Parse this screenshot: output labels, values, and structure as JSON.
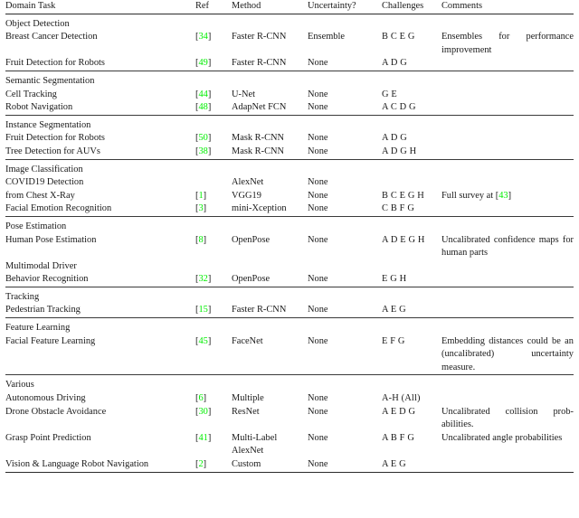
{
  "table": {
    "columns": [
      {
        "key": "domain",
        "label": "Domain Task"
      },
      {
        "key": "ref",
        "label": "Ref"
      },
      {
        "key": "method",
        "label": "Method"
      },
      {
        "key": "uncertainty",
        "label": "Uncertainty?"
      },
      {
        "key": "challenges",
        "label": "Challenges"
      },
      {
        "key": "comments",
        "label": "Comments"
      }
    ],
    "ref_color": "#00ee00",
    "sections": [
      {
        "name": "Object Detection",
        "rows": [
          {
            "domain": "Breast Cancer Detection",
            "ref_open": "[",
            "ref_num": "34",
            "ref_close": "]",
            "method": "Faster R-CNN",
            "uncertainty": "Ensemble",
            "challenges": "B C E G",
            "comments": "Ensembles for performance improvement"
          },
          {
            "domain": "Fruit Detection for Robots",
            "ref_open": "[",
            "ref_num": "49",
            "ref_close": "]",
            "method": "Faster R-CNN",
            "uncertainty": "None",
            "challenges": "A D G",
            "comments": ""
          }
        ]
      },
      {
        "name": "Semantic Segmentation",
        "rows": [
          {
            "domain": "Cell Tracking",
            "ref_open": "[",
            "ref_num": "44",
            "ref_close": "]",
            "method": "U-Net",
            "uncertainty": "None",
            "challenges": "G E",
            "comments": ""
          },
          {
            "domain": "Robot Navigation",
            "ref_open": "[",
            "ref_num": "48",
            "ref_close": "]",
            "method": "AdapNet FCN",
            "uncertainty": "None",
            "challenges": "A C D G",
            "comments": ""
          }
        ]
      },
      {
        "name": "Instance Segmentation",
        "rows": [
          {
            "domain": "Fruit Detection for Robots",
            "ref_open": "[",
            "ref_num": "50",
            "ref_close": "]",
            "method": "Mask R-CNN",
            "uncertainty": "None",
            "challenges": "A D G",
            "comments": ""
          },
          {
            "domain": "Tree Detection for AUVs",
            "ref_open": "[",
            "ref_num": "38",
            "ref_close": "]",
            "method": "Mask R-CNN",
            "uncertainty": "None",
            "challenges": "A D G H",
            "comments": ""
          }
        ]
      },
      {
        "name": "Image Classification",
        "rows": [
          {
            "domain": "COVID19 Detection",
            "ref_open": "",
            "ref_num": "",
            "ref_close": "",
            "method": "AlexNet",
            "uncertainty": "None",
            "challenges": "",
            "comments": ""
          },
          {
            "domain": "from Chest X-Ray",
            "ref_open": "[",
            "ref_num": "1",
            "ref_close": "]",
            "method": "VGG19",
            "uncertainty": "None",
            "challenges": "B C E G H",
            "comments_pre": "Full survey at ",
            "comments_ref_open": "[",
            "comments_ref_num": "43",
            "comments_ref_close": "]",
            "comments": ""
          },
          {
            "domain": "Facial Emotion Recognition",
            "ref_open": "[",
            "ref_num": "3",
            "ref_close": "]",
            "method": "mini-Xception",
            "uncertainty": "None",
            "challenges": "C B F G",
            "comments": ""
          }
        ]
      },
      {
        "name": "Pose Estimation",
        "rows": [
          {
            "domain": "Human Pose Estimation",
            "ref_open": "[",
            "ref_num": "8",
            "ref_close": "]",
            "method": "OpenPose",
            "uncertainty": "None",
            "challenges": "A D E G H",
            "comments": "Uncalibrated confidence maps for human parts"
          },
          {
            "domain": "Multimodal Driver",
            "ref_open": "",
            "ref_num": "",
            "ref_close": "",
            "method": "",
            "uncertainty": "",
            "challenges": "",
            "comments": ""
          },
          {
            "domain": "Behavior Recognition",
            "ref_open": "[",
            "ref_num": "32",
            "ref_close": "]",
            "method": "OpenPose",
            "uncertainty": "None",
            "challenges": "E G H",
            "comments": ""
          }
        ]
      },
      {
        "name": "Tracking",
        "rows": [
          {
            "domain": "Pedestrian Tracking",
            "ref_open": "[",
            "ref_num": "15",
            "ref_close": "]",
            "method": "Faster R-CNN",
            "uncertainty": "None",
            "challenges": "A E G",
            "comments": ""
          }
        ]
      },
      {
        "name": "Feature Learning",
        "rows": [
          {
            "domain": "Facial Feature Learning",
            "ref_open": "[",
            "ref_num": "45",
            "ref_close": "]",
            "method": "FaceNet",
            "uncertainty": "None",
            "challenges": "E F G",
            "comments": "Embedding distances could be an (uncalibrated) uncer­tainty measure."
          }
        ]
      },
      {
        "name": "Various",
        "rows": [
          {
            "domain": "Autonomous Driving",
            "ref_open": "[",
            "ref_num": "6",
            "ref_close": "]",
            "method": "Multiple",
            "uncertainty": "None",
            "challenges": "A-H (All)",
            "comments": ""
          },
          {
            "domain": "Drone Obstacle Avoidance",
            "ref_open": "[",
            "ref_num": "30",
            "ref_close": "]",
            "method": "ResNet",
            "uncertainty": "None",
            "challenges": "A E D G",
            "comments": "Uncalibrated collision prob­abilities."
          },
          {
            "domain": "Grasp Point Prediction",
            "ref_open": "[",
            "ref_num": "41",
            "ref_close": "]",
            "method": "Multi-Label",
            "uncertainty": "None",
            "challenges": "A B F G",
            "comments": "Uncalibrated angle probabil­ities"
          },
          {
            "domain": "",
            "ref_open": "",
            "ref_num": "",
            "ref_close": "",
            "method": "AlexNet",
            "uncertainty": "",
            "challenges": "",
            "comments": ""
          },
          {
            "domain": "Vision & Language Robot Navigation",
            "ref_open": "[",
            "ref_num": "2",
            "ref_close": "]",
            "method": "Custom",
            "uncertainty": "None",
            "challenges": "A E G",
            "comments": ""
          }
        ]
      }
    ]
  }
}
